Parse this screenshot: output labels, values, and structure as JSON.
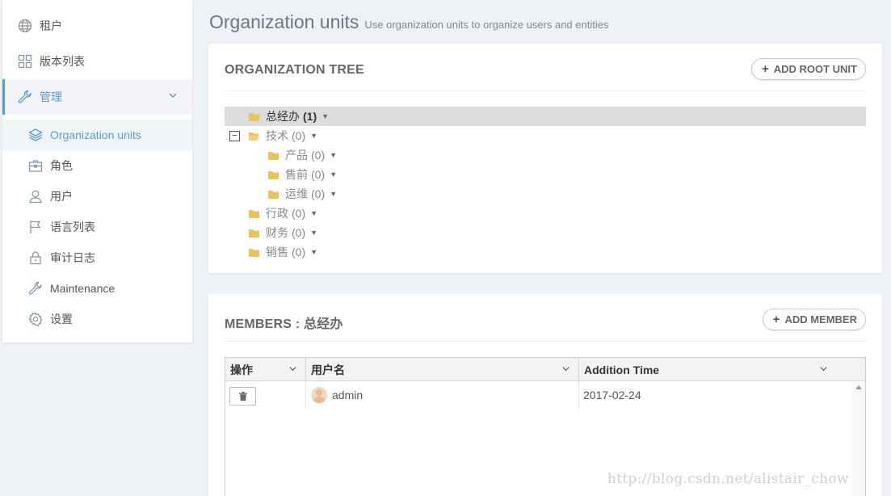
{
  "sidebar": {
    "items": [
      {
        "label": "租户",
        "icon": "globe-icon"
      },
      {
        "label": "版本列表",
        "icon": "grid-icon"
      },
      {
        "label": "管理",
        "icon": "wrench-icon"
      }
    ],
    "sub_items": [
      {
        "label": "Organization units",
        "icon": "layers-icon"
      },
      {
        "label": "角色",
        "icon": "briefcase-icon"
      },
      {
        "label": "用户",
        "icon": "user-icon"
      },
      {
        "label": "语言列表",
        "icon": "flag-icon"
      },
      {
        "label": "审计日志",
        "icon": "lock-icon"
      },
      {
        "label": "Maintenance",
        "icon": "wrench-icon"
      },
      {
        "label": "设置",
        "icon": "gear-icon"
      }
    ]
  },
  "header": {
    "title": "Organization units",
    "subtitle": "Use organization units to organize users and entities"
  },
  "tree_panel": {
    "title": "ORGANIZATION TREE",
    "add_button": "ADD ROOT UNIT",
    "nodes": [
      {
        "label": "总经办",
        "count": "(1)"
      },
      {
        "label": "技术",
        "count": "(0)"
      },
      {
        "label": "产品",
        "count": "(0)"
      },
      {
        "label": "售前",
        "count": "(0)"
      },
      {
        "label": "运维",
        "count": "(0)"
      },
      {
        "label": "行政",
        "count": "(0)"
      },
      {
        "label": "财务",
        "count": "(0)"
      },
      {
        "label": "销售",
        "count": "(0)"
      }
    ]
  },
  "members_panel": {
    "title": "MEMBERS : 总经办",
    "add_button": "ADD MEMBER",
    "columns": [
      "操作",
      "用户名",
      "Addition Time"
    ],
    "rows": [
      {
        "username": "admin",
        "addition_time": "2017-02-24"
      }
    ]
  },
  "watermark": "http://blog.csdn.net/alistair_chow",
  "colors": {
    "accent": "#5b9bd1",
    "folder": "#e8c25a",
    "background": "#eef1f5"
  }
}
